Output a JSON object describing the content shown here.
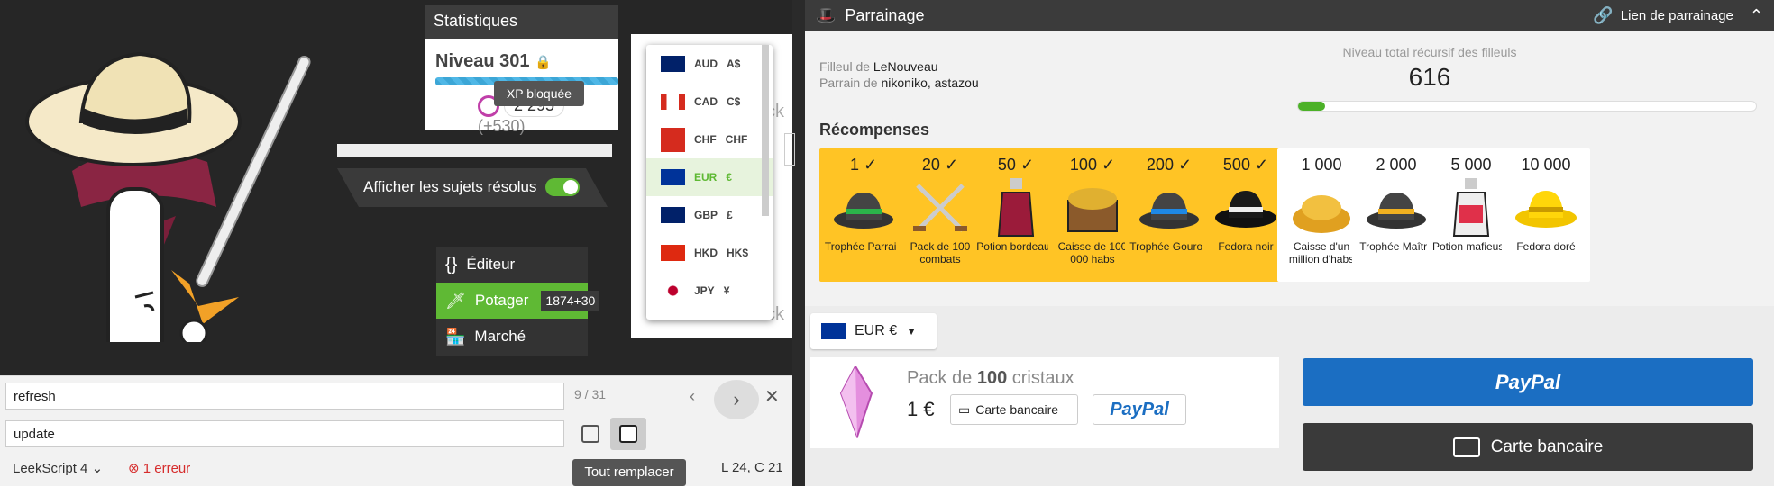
{
  "stats": {
    "title": "Statistiques",
    "level": "Niveau 301",
    "xp_tooltip": "XP bloquée",
    "habs": "2 295",
    "habs_gain": "(+530)"
  },
  "toggle": {
    "label": "Afficher les sujets résolus"
  },
  "menu": {
    "items": [
      {
        "label": "Éditeur"
      },
      {
        "label": "Potager",
        "count": "1874+30"
      },
      {
        "label": "Marché"
      }
    ]
  },
  "currencies": [
    {
      "code": "AUD",
      "sym": "A$"
    },
    {
      "code": "CAD",
      "sym": "C$"
    },
    {
      "code": "CHF",
      "sym": "CHF"
    },
    {
      "code": "EUR",
      "sym": "€"
    },
    {
      "code": "GBP",
      "sym": "£"
    },
    {
      "code": "HKD",
      "sym": "HK$"
    },
    {
      "code": "JPY",
      "sym": "¥"
    }
  ],
  "partial": {
    "text1": "ck",
    "text2": "ck"
  },
  "search": {
    "find": "refresh",
    "replace": "update",
    "count": "9 / 31",
    "replace_all_tooltip": "Tout remplacer"
  },
  "status": {
    "language": "LeekScript 4",
    "errors": "1 erreur",
    "position": "L 24, C 21"
  },
  "parrainage": {
    "title": "Parrainage",
    "link_label": "Lien de parrainage",
    "filleul_prefix": "Filleul de",
    "filleul_name": "LeNouveau",
    "parrain_prefix": "Parrain de",
    "parrain_names": "nikoniko, astazou",
    "total_label": "Niveau total récursif des filleuls",
    "total_value": "616",
    "total_progress": 0.06,
    "rewards_title": "Récompenses",
    "rewards": [
      {
        "num": "1",
        "check": "✓",
        "name": "Trophée Parrain",
        "done": true,
        "icon": "hat-green-band-icon"
      },
      {
        "num": "20",
        "check": "✓",
        "name": "Pack de 100 combats",
        "done": true,
        "icon": "crossed-swords-icon"
      },
      {
        "num": "50",
        "check": "✓",
        "name": "Potion bordeaux",
        "done": true,
        "icon": "potion-bordeaux-icon"
      },
      {
        "num": "100",
        "check": "✓",
        "name": "Caisse de 100 000 habs",
        "done": true,
        "icon": "treasure-chest-icon"
      },
      {
        "num": "200",
        "check": "✓",
        "name": "Trophée Gourou",
        "done": true,
        "icon": "hat-blue-band-icon"
      },
      {
        "num": "500",
        "check": "✓",
        "name": "Fedora noir",
        "done": true,
        "icon": "black-fedora-icon"
      },
      {
        "num": "1 000",
        "check": "",
        "name": "Caisse d'un million d'habs",
        "done": false,
        "icon": "gold-pile-icon"
      },
      {
        "num": "2 000",
        "check": "",
        "name": "Trophée Maître",
        "done": false,
        "icon": "hat-gold-band-icon"
      },
      {
        "num": "5 000",
        "check": "",
        "name": "Potion mafieuse",
        "done": false,
        "icon": "potion-mafia-icon"
      },
      {
        "num": "10 000",
        "check": "",
        "name": "Fedora doré",
        "done": false,
        "icon": "gold-fedora-icon"
      }
    ]
  },
  "shop": {
    "currency": "EUR €",
    "pack_prefix": "Pack de",
    "pack_amount": "100",
    "pack_suffix": "cristaux",
    "price": "1 €",
    "card_label": "Carte bancaire",
    "paypal_label": "PayPal",
    "paypal_button": "PayPal",
    "card_button": "Carte bancaire"
  },
  "colors": {
    "accent": "#5fb934",
    "gold": "#ffc425",
    "paypal": "#1b6ec2"
  }
}
